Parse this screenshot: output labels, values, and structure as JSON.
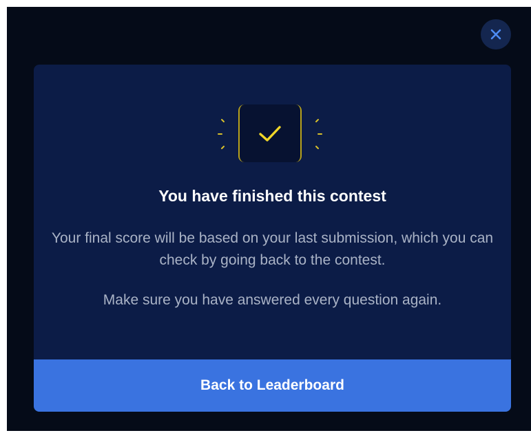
{
  "modal": {
    "title": "You have finished this contest",
    "message_primary": "Your final score will be based on your last submission, which you can check by going back to the contest.",
    "message_secondary": "Make sure you have answered every question again.",
    "cta_label": "Back to Leaderboard"
  },
  "icons": {
    "close": "close-icon",
    "success": "check-icon"
  },
  "colors": {
    "background": "#050b18",
    "modal": "#0c1c47",
    "accent": "#3a73e0",
    "check": "#f0d628",
    "badge_border": "#b9a31c"
  }
}
